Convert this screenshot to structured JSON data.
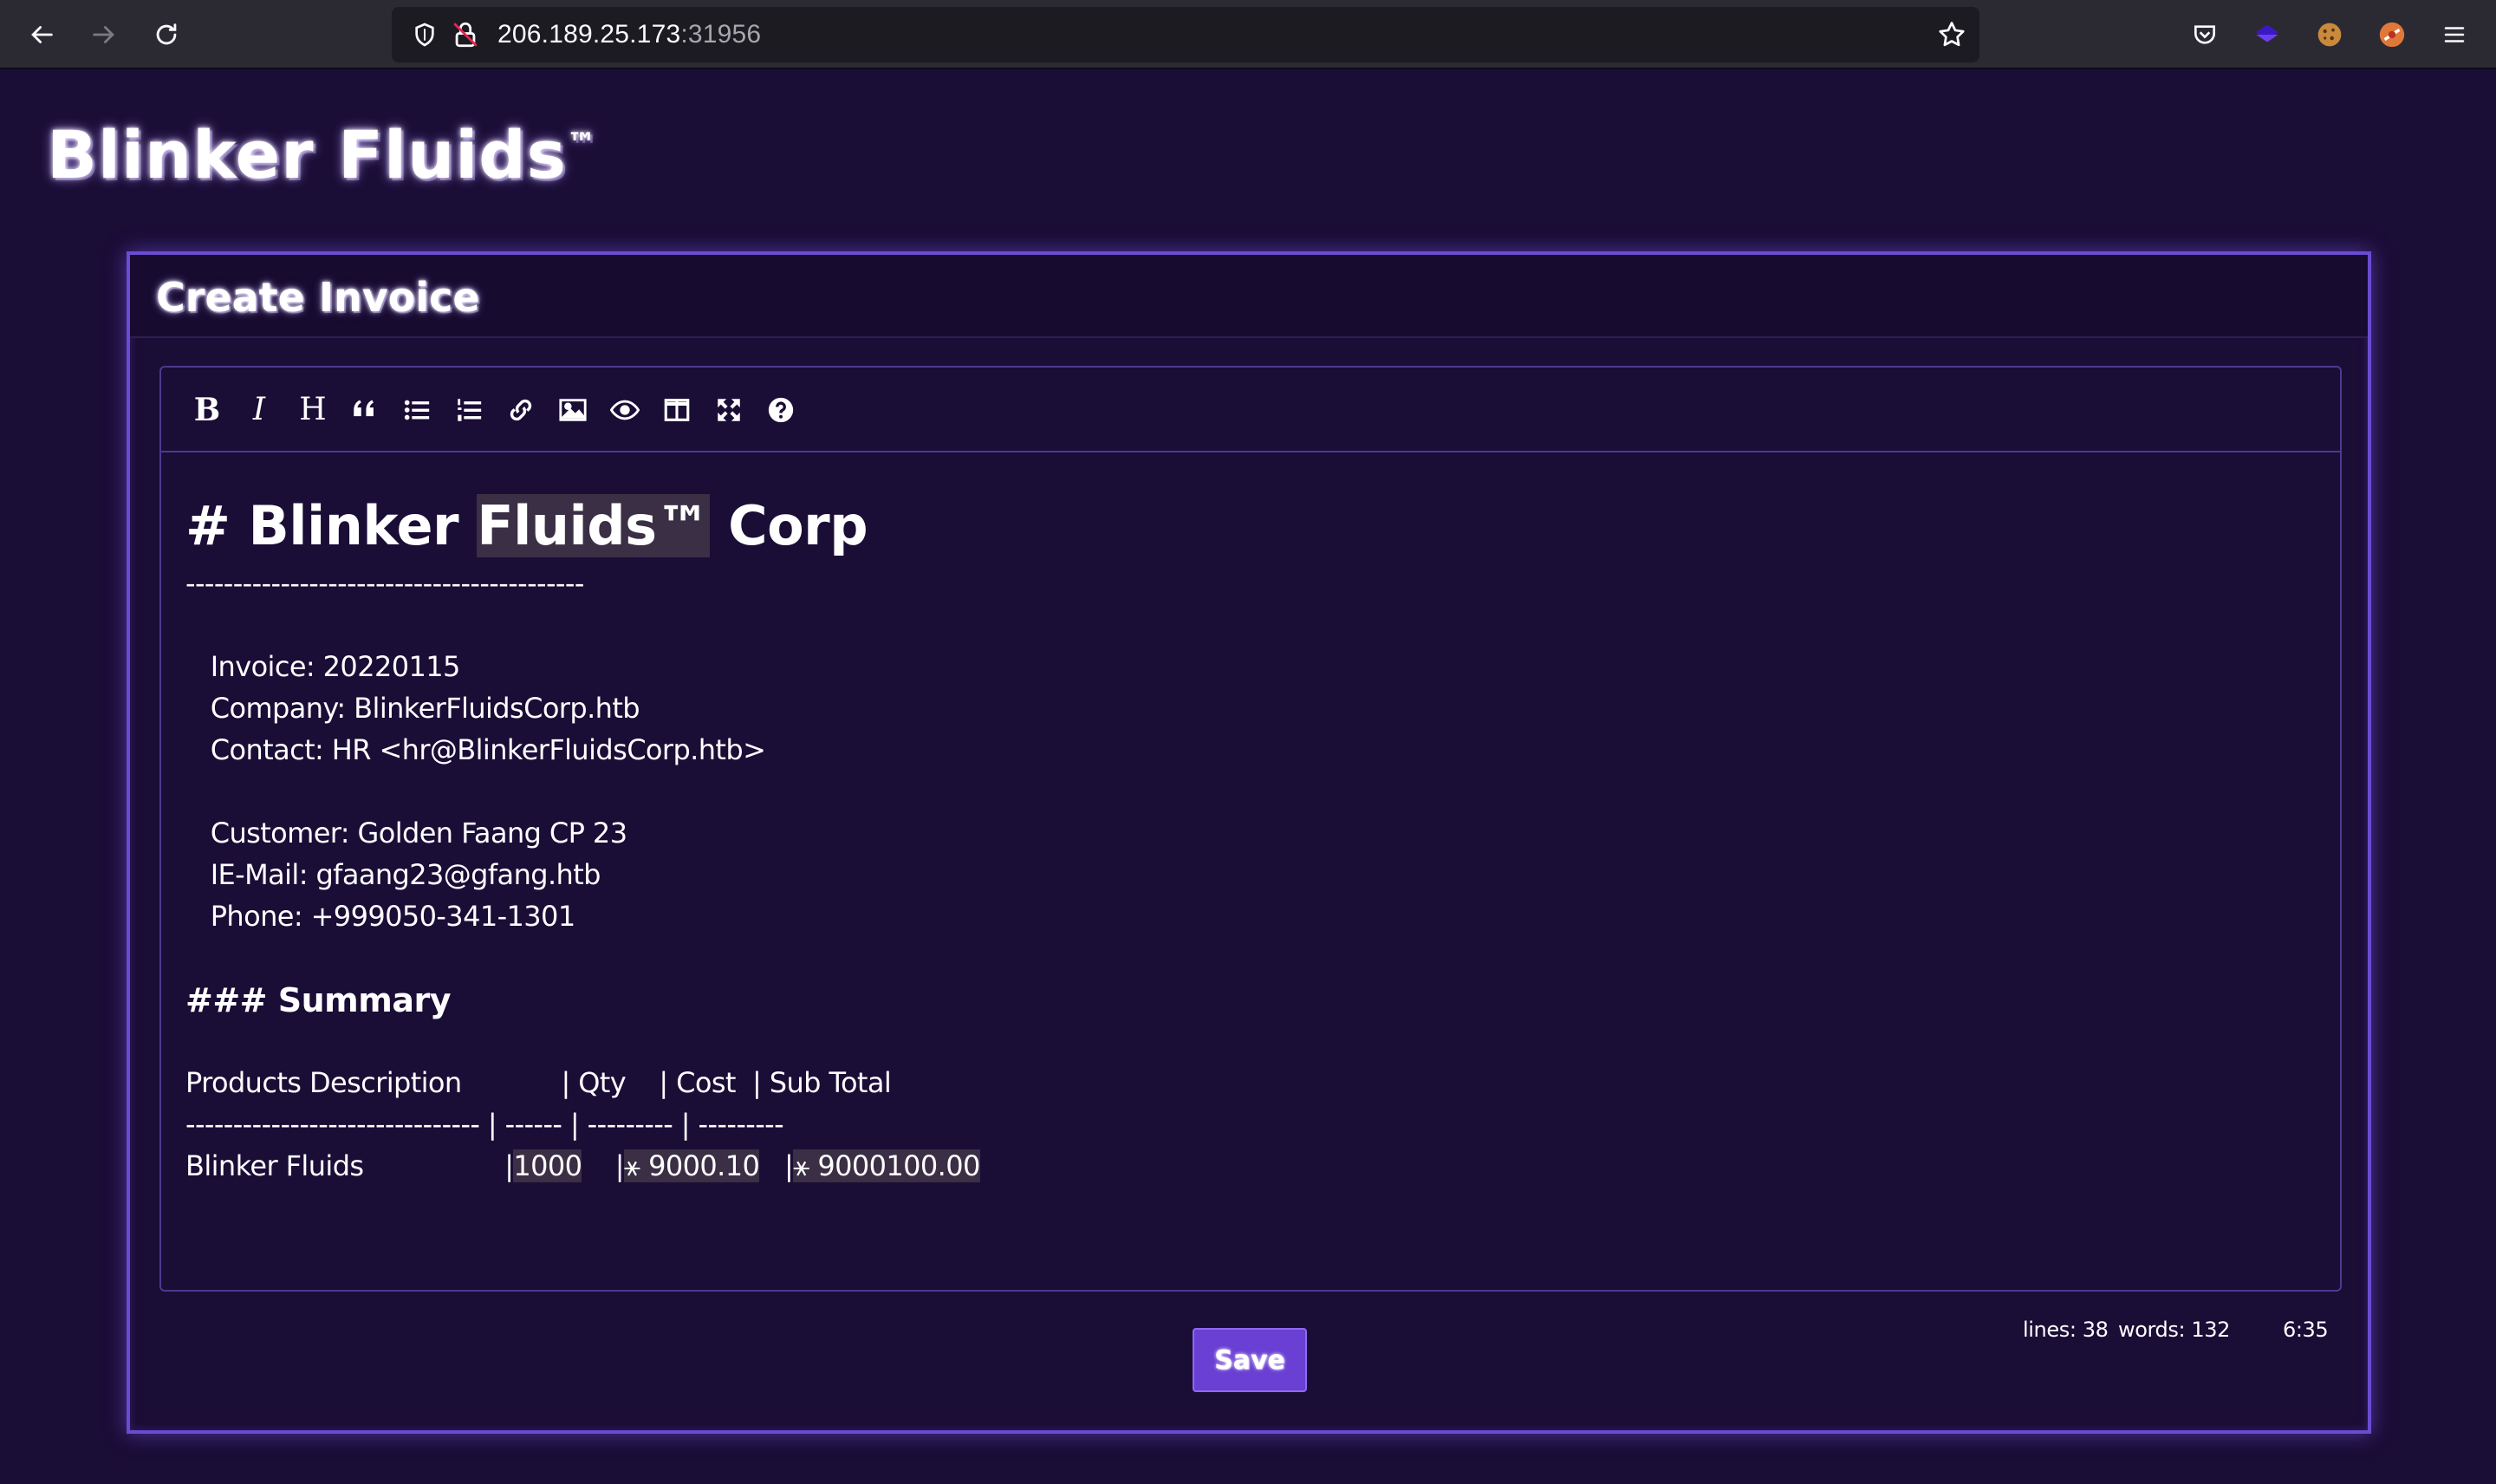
{
  "browser": {
    "url_host": "206.189.25.173",
    "url_port": ":31956",
    "icons": [
      "back-arrow-icon",
      "forward-arrow-icon",
      "reload-icon",
      "shield-icon",
      "lock-icon",
      "star-icon",
      "pocket-icon",
      "extension-icon",
      "cookie-icon",
      "extension-icon",
      "menu-icon"
    ]
  },
  "brand": {
    "name": "Blinker Fluids",
    "tm": "™"
  },
  "card": {
    "title": "Create Invoice"
  },
  "toolbar": {
    "bold": "B",
    "italic": "I",
    "heading": "H",
    "icons": [
      "bold-icon",
      "italic-icon",
      "heading-icon",
      "quote-icon",
      "unordered-list-icon",
      "ordered-list-icon",
      "link-icon",
      "image-icon",
      "preview-icon",
      "side-by-side-icon",
      "fullscreen-icon",
      "help-icon"
    ]
  },
  "editor": {
    "h1_prefix": "# Blinker ",
    "h1_highlight": "Fluids™",
    "h1_suffix": " Corp",
    "rule": "------------------------------------------",
    "invoice": "   Invoice: 20220115",
    "company": "   Company: BlinkerFluidsCorp.htb",
    "contact": "   Contact: HR <hr@BlinkerFluidsCorp.htb>",
    "customer": "   Customer: Golden Faang CP 23",
    "email": "   IE-Mail: gfaang23@gfang.htb",
    "phone": "   Phone: +999050-341-1301",
    "summary": "### Summary",
    "table_header": "Products Description            | Qty    | Cost  | Sub Total",
    "table_rule": "------------------------------- | ------ | --------- | ---------",
    "row_product": "Blinker Fluids                 |",
    "row_qty": "1000",
    "row_sep1": "    |",
    "row_cost": "⚹ 9000.10",
    "row_sep2": "   |",
    "row_subtotal": "⚹ 9000100.00"
  },
  "status": {
    "lines": "lines: 38",
    "words": "words: 132",
    "cursor": "6:35"
  },
  "save_label": "Save"
}
